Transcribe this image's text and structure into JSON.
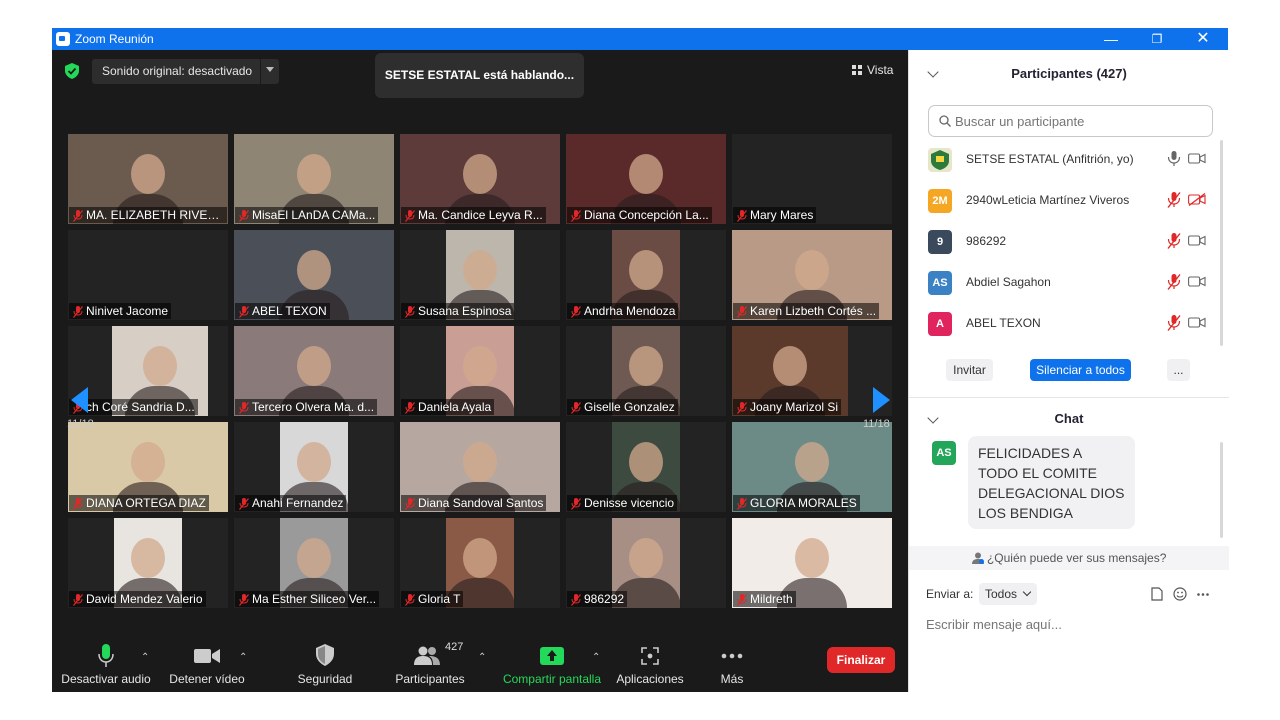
{
  "window": {
    "title": "Zoom Reunión"
  },
  "meeting": {
    "audio_select": "Sonido original: desactivado",
    "speaker_banner": "SETSE ESTATAL está hablando...",
    "view_label": "Vista",
    "page_left": "11/18",
    "page_right": "11/18"
  },
  "tiles": [
    {
      "name": "MA. ELIZABETH RIVER...",
      "bg": "#6b5a4e"
    },
    {
      "name": "MisaEl LAnDA CAMa...",
      "bg": "#8f8575"
    },
    {
      "name": "Ma. Candice Leyva R...",
      "bg": "#5c3b3a"
    },
    {
      "name": "Diana Concepción La...",
      "bg": "#5a2a2a"
    },
    {
      "name": "Mary Mares",
      "bg": ""
    },
    {
      "name": "Ninivet Jacome",
      "bg": ""
    },
    {
      "name": "ABEL TEXON",
      "bg": "#4a4f58"
    },
    {
      "name": "Susana Espinosa",
      "bg": "#bcb6ad"
    },
    {
      "name": "Andrha Mendoza",
      "bg": "#6a4c45"
    },
    {
      "name": "Karen Lizbeth Cortés ...",
      "bg": "#b99a86"
    },
    {
      "name": "ch Coré Sandria D...",
      "bg": "#d7cfc5"
    },
    {
      "name": "Tercero Olvera Ma. d...",
      "bg": "#8a7a7a"
    },
    {
      "name": "Daniela Ayala",
      "bg": "#c99f95"
    },
    {
      "name": "Giselle Gonzalez",
      "bg": "#6e5a52"
    },
    {
      "name": "Joany Marizol Si",
      "bg": "#5b3a2c"
    },
    {
      "name": "DIANA ORTEGA DIAZ",
      "bg": "#d9c9a7"
    },
    {
      "name": "Anahi Fernandez",
      "bg": "#d8d8d8"
    },
    {
      "name": "Diana Sandoval Santos",
      "bg": "#b6a7a0"
    },
    {
      "name": "Denisse vicencio",
      "bg": "#3d4a3f"
    },
    {
      "name": "GLORIA MORALES",
      "bg": "#6c8b87"
    },
    {
      "name": "David Mendez Valerio",
      "bg": "#e8e4df"
    },
    {
      "name": "Ma Esther Siliceo Ver...",
      "bg": "#9a9a9a"
    },
    {
      "name": "Gloria T",
      "bg": "#8a5a46"
    },
    {
      "name": "986292",
      "bg": "#a88f86"
    },
    {
      "name": "Mildreth",
      "bg": "#f2ece8"
    }
  ],
  "toolbar": {
    "mute_label": "Desactivar audio",
    "video_label": "Detener vídeo",
    "security_label": "Seguridad",
    "participants_label": "Participantes",
    "participants_count": "427",
    "share_label": "Compartir pantalla",
    "apps_label": "Aplicaciones",
    "more_label": "Más",
    "end_label": "Finalizar"
  },
  "panel": {
    "participants_title": "Participantes (427)",
    "search_placeholder": "Buscar un participante",
    "participants": [
      {
        "initials": "",
        "name": "SETSE ESTATAL (Anfitrión, yo)",
        "color": "#e8e6c8",
        "muted": false,
        "video_off": false
      },
      {
        "initials": "2M",
        "name": "2940wLeticia Martínez Viveros",
        "color": "#f5a623",
        "muted": true,
        "video_off": true
      },
      {
        "initials": "9",
        "name": "986292",
        "color": "#3a4a5c",
        "muted": true,
        "video_off": false
      },
      {
        "initials": "AS",
        "name": "Abdiel Sagahon",
        "color": "#3b82c4",
        "muted": true,
        "video_off": false
      },
      {
        "initials": "A",
        "name": "ABEL TEXON",
        "color": "#e0245e",
        "muted": true,
        "video_off": false
      }
    ],
    "invite_label": "Invitar",
    "mute_all_label": "Silenciar a todos",
    "more_label": "...",
    "chat_title": "Chat",
    "chat_message": {
      "initials": "AS",
      "text": "FELICIDADES A TODO EL COMITE DELEGACIONAL DIOS LOS BENDIGA"
    },
    "who_sees": "¿Quién puede ver sus mensajes?",
    "send_to_label": "Enviar a:",
    "send_to_value": "Todos",
    "chat_placeholder": "Escribir mensaje aquí..."
  }
}
